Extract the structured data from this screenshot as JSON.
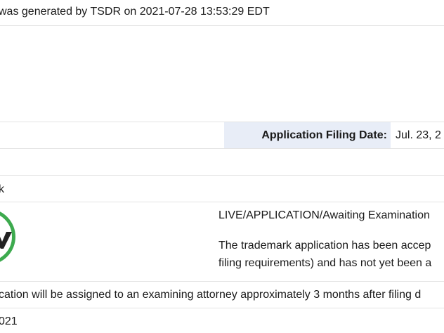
{
  "header": {
    "generated_text": "was generated by TSDR on 2021-07-28 13:53:29 EDT"
  },
  "filing": {
    "label": "Application Filing Date:",
    "value": "Jul. 23, 2"
  },
  "mark_row": {
    "fragment": "k"
  },
  "status": {
    "text": "LIVE/APPLICATION/Awaiting Examination",
    "description_line1": "The trademark application has been accep",
    "description_line2": "filing requirements) and has not yet been a",
    "icon_color": "#3daa4e"
  },
  "note": {
    "text": "cation will be assigned to an examining attorney approximately 3 months after filing d"
  },
  "date_row": {
    "fragment": "021"
  },
  "colors": {
    "label_bg": "#e8edf7",
    "divider": "#e3e3e3",
    "status_green": "#3daa4e"
  }
}
